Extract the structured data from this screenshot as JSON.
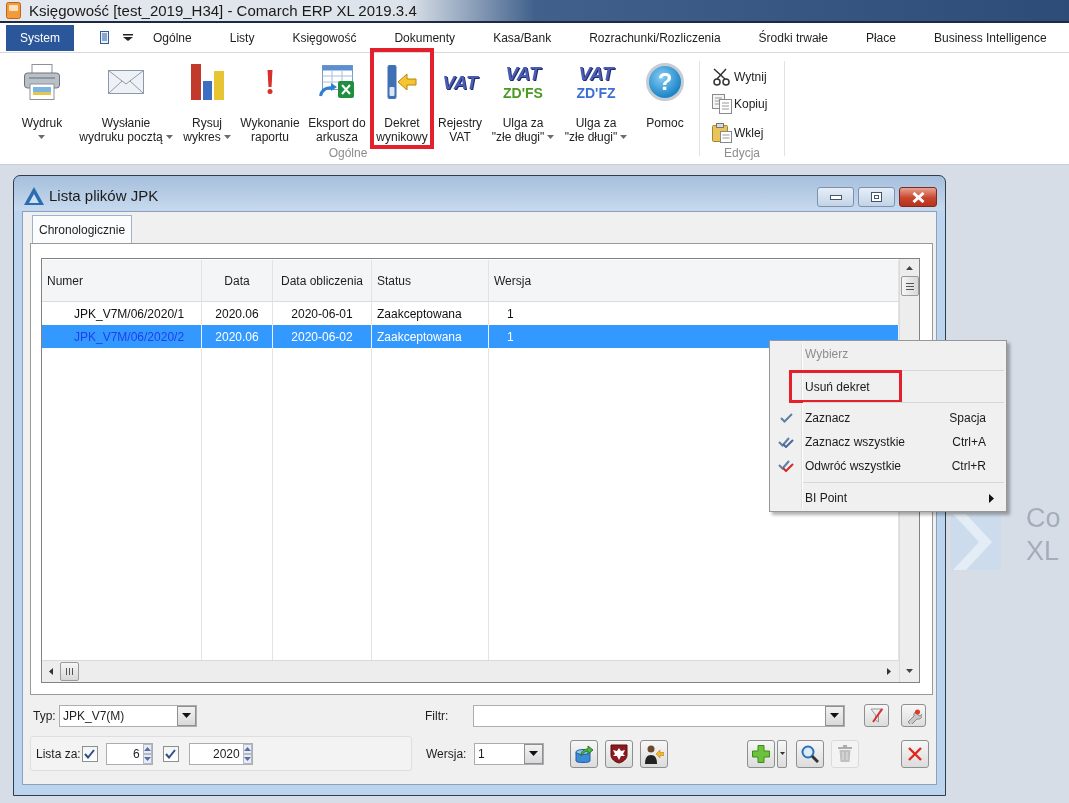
{
  "app_window": {
    "title": "Księgowość [test_2019_H34] - Comarch ERP XL 2019.3.4"
  },
  "menu_bar": {
    "system_button": "System",
    "tabs": [
      "Ogólne",
      "Listy",
      "Księgowość",
      "Dokumenty",
      "Kasa/Bank",
      "Rozrachunki/Rozliczenia",
      "Środki trwałe",
      "Płace",
      "Business Intelligence"
    ]
  },
  "ribbon": {
    "groups": [
      {
        "label": "Ogólne",
        "buttons": [
          {
            "label_lines": [
              "Wydruk"
            ],
            "dropdown": true,
            "highlighted": false
          },
          {
            "label_lines": [
              "Wysłanie",
              "wydruku pocztą"
            ],
            "dropdown": true,
            "highlighted": false
          },
          {
            "label_lines": [
              "Rysuj",
              "wykres"
            ],
            "dropdown": true,
            "highlighted": false
          },
          {
            "label_lines": [
              "Wykonanie",
              "raportu"
            ],
            "dropdown": false,
            "highlighted": false
          },
          {
            "label_lines": [
              "Eksport do",
              "arkusza"
            ],
            "dropdown": false,
            "highlighted": false
          },
          {
            "label_lines": [
              "Dekret",
              "wynikowy"
            ],
            "dropdown": false,
            "highlighted": true
          },
          {
            "label_lines": [
              "Rejestry",
              "VAT"
            ],
            "dropdown": false,
            "highlighted": false,
            "icon_text": [
              "VAT"
            ]
          },
          {
            "label_lines": [
              "Ulga za",
              "\"złe długi\""
            ],
            "dropdown": true,
            "highlighted": false,
            "icon_text": [
              "VAT",
              "ZD'FS"
            ]
          },
          {
            "label_lines": [
              "Ulga za",
              "\"złe długi\""
            ],
            "dropdown": true,
            "highlighted": false,
            "icon_text": [
              "VAT",
              "ZD'FZ"
            ]
          },
          {
            "label_lines": [
              "Pomoc"
            ],
            "dropdown": false,
            "highlighted": false,
            "icon_text": [
              "?"
            ]
          }
        ]
      },
      {
        "label": "Edycja",
        "buttons": [
          {
            "label": "Wytnij"
          },
          {
            "label": "Kopiuj"
          },
          {
            "label": "Wklej"
          }
        ]
      }
    ]
  },
  "child_window": {
    "title": "Lista plików JPK",
    "tabs": [
      {
        "label": "Chronologicznie",
        "selected": true
      }
    ],
    "table": {
      "columns": [
        "Numer",
        "Data",
        "Data obliczenia",
        "Status",
        "Wersja"
      ],
      "rows": [
        {
          "cells": [
            "JPK_V7M/06/2020/1",
            "2020.06",
            "2020-06-01",
            "Zaakceptowana",
            "1"
          ],
          "selected": false
        },
        {
          "cells": [
            "JPK_V7M/06/2020/2",
            "2020.06",
            "2020-06-02",
            "Zaakceptowana",
            "1"
          ],
          "selected": true
        }
      ]
    },
    "filters": {
      "type": {
        "label": "Typ:",
        "value": "JPK_V7(M)"
      },
      "filter": {
        "label": "Filtr:"
      },
      "period": {
        "label": "Lista za:",
        "month_checked": true,
        "month": "6",
        "year_checked": true,
        "year": "2020"
      },
      "version": {
        "label": "Wersja:",
        "value": "1"
      }
    },
    "filter_buttons": [
      {
        "disabled": false
      },
      {
        "disabled": false
      }
    ],
    "action_buttons": [
      {
        "disabled": false
      },
      {
        "disabled": false
      },
      {
        "disabled": false
      },
      {
        "disabled": false
      },
      {
        "disabled": false
      },
      {
        "disabled": true
      },
      {
        "disabled": false
      }
    ]
  },
  "context_menu": {
    "items": [
      {
        "kind": "command",
        "label": "Wybierz",
        "disabled": true,
        "highlighted": false
      },
      {
        "kind": "separator"
      },
      {
        "kind": "command",
        "label": "Usuń dekret",
        "disabled": false,
        "highlighted": true
      },
      {
        "kind": "separator"
      },
      {
        "kind": "command",
        "label": "Zaznacz",
        "shortcut": "Spacja",
        "disabled": false,
        "highlighted": false
      },
      {
        "kind": "command",
        "label": "Zaznacz wszystkie",
        "shortcut": "Ctrl+A",
        "disabled": false,
        "highlighted": false
      },
      {
        "kind": "command",
        "label": "Odwróć wszystkie",
        "shortcut": "Ctrl+R",
        "disabled": false,
        "highlighted": false
      },
      {
        "kind": "separator"
      },
      {
        "kind": "submenu",
        "label": "BI Point",
        "disabled": false,
        "highlighted": false
      }
    ]
  },
  "background_logo": {
    "lines": [
      "Co",
      "XL"
    ]
  }
}
